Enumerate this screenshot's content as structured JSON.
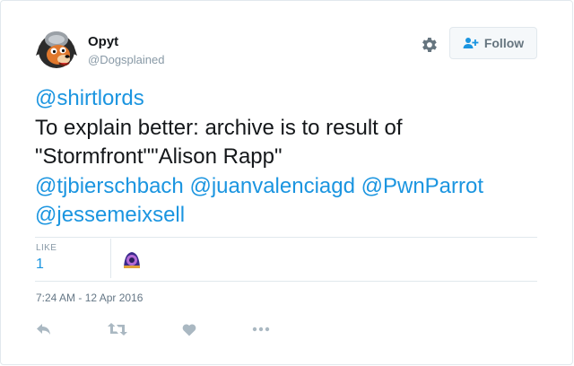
{
  "user": {
    "name": "Opyt",
    "handle": "@Dogsplained"
  },
  "header": {
    "follow_label": "Follow"
  },
  "tweet": {
    "line1_mention": "@shirtlords",
    "line2": "To explain better: archive is to result of",
    "line3": "\"Stormfront\"\"Alison Rapp\"",
    "mentions_line4": [
      "@tjbierschbach",
      "@juanvalenciagd",
      "@PwnParrot"
    ],
    "mention_line5": "@jessemeixsell"
  },
  "stats": {
    "like_label": "LIKE",
    "like_count": "1"
  },
  "timestamp": "7:24 AM - 12 Apr 2016",
  "icons": {
    "settings": "gear-icon",
    "follow": "user-plus-icon",
    "reply": "reply-icon",
    "retweet": "retweet-icon",
    "like": "heart-icon",
    "more": "more-icon"
  },
  "colors": {
    "link": "#1b95e0",
    "muted": "#8899a6",
    "icon": "#aab8c2"
  }
}
